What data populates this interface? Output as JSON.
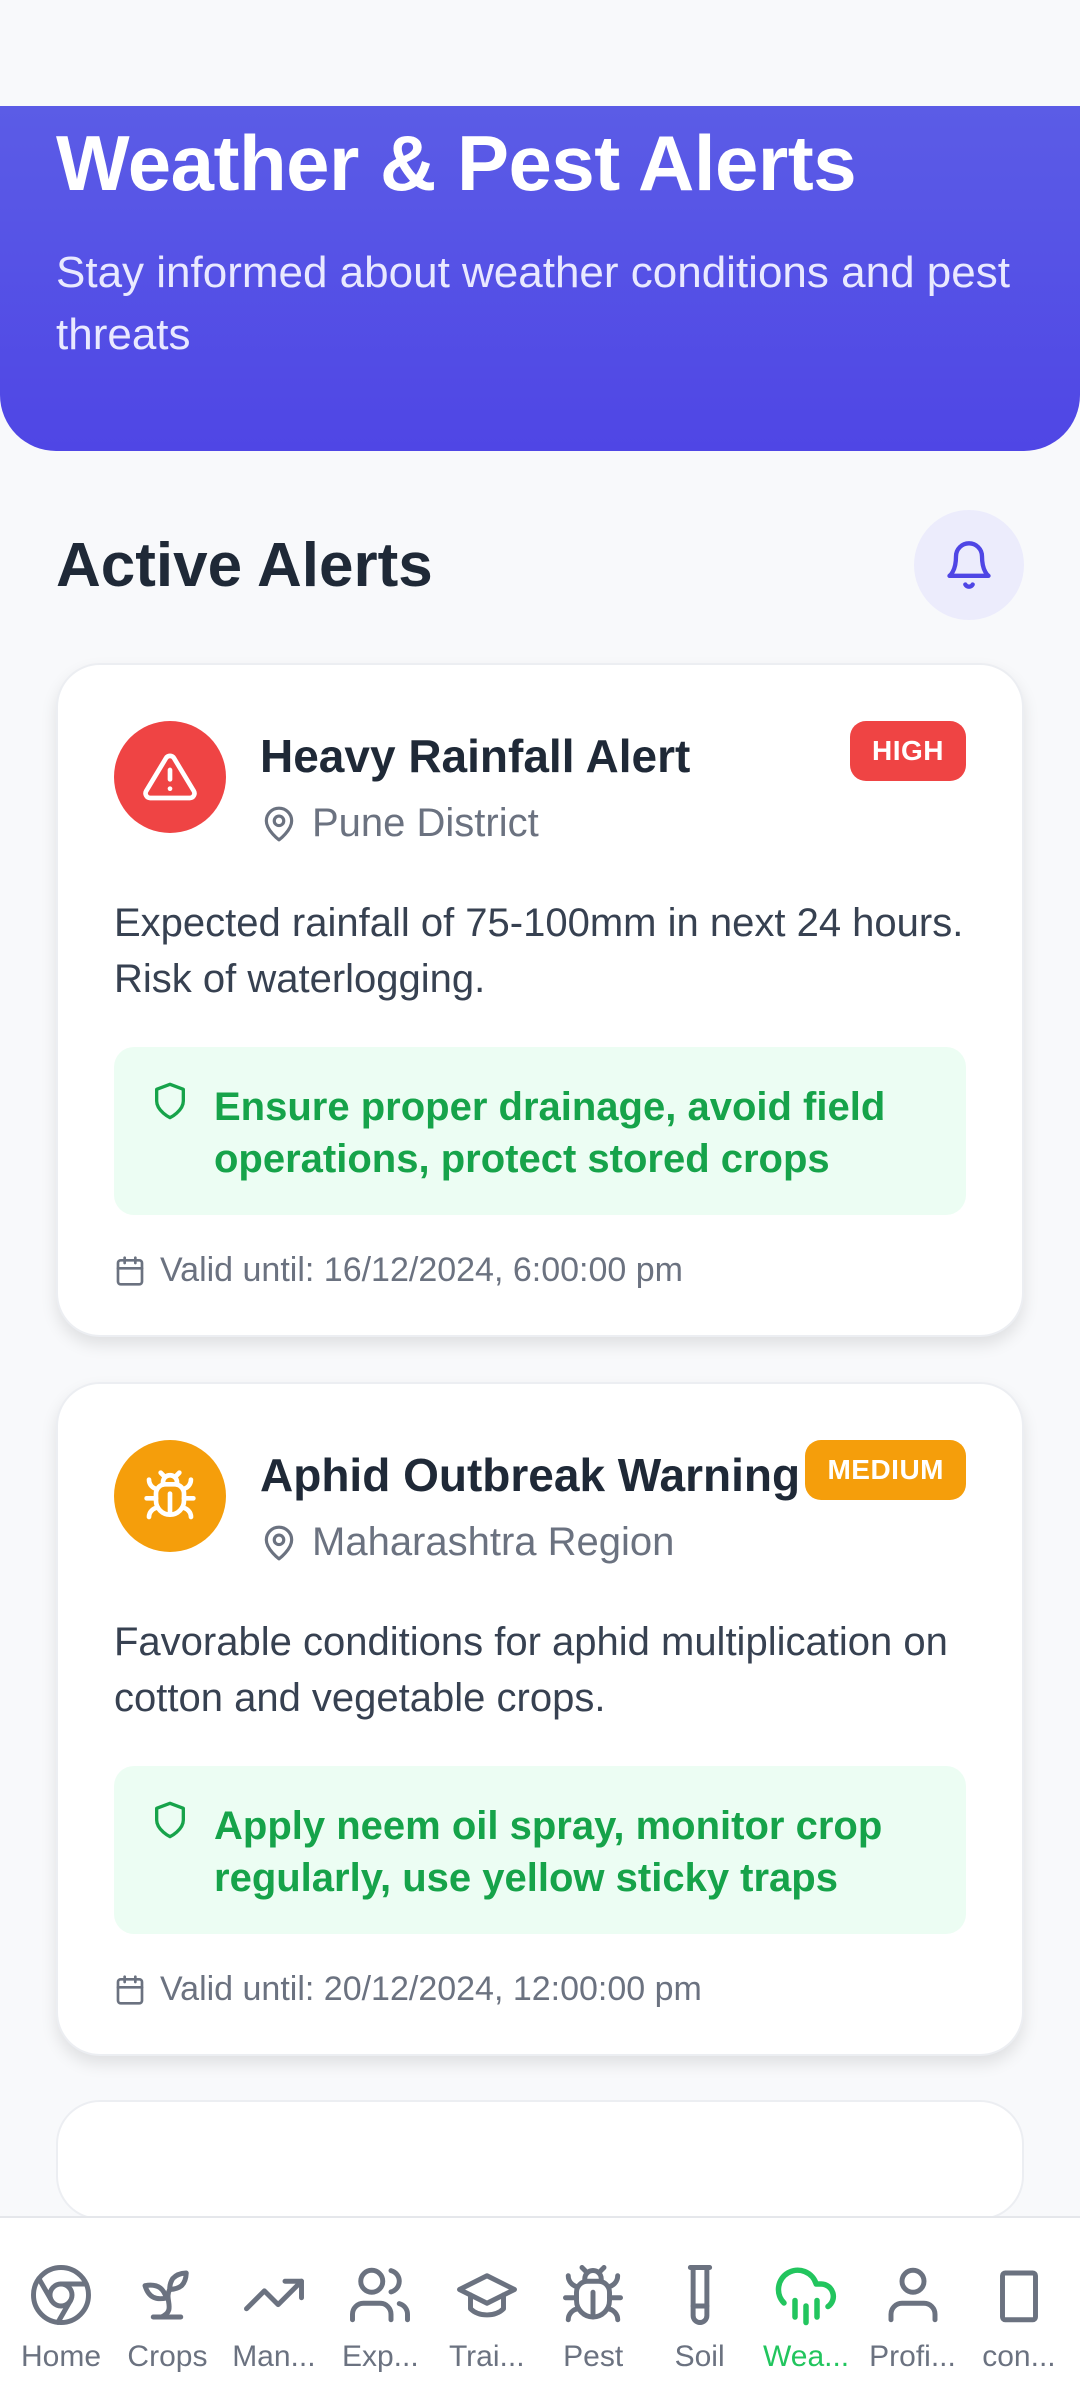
{
  "header": {
    "title": "Weather & Pest Alerts",
    "subtitle": "Stay informed about weather conditions and pest threats"
  },
  "section": {
    "title": "Active Alerts"
  },
  "alerts": [
    {
      "title": "Heavy Rainfall Alert",
      "severity": "HIGH",
      "location": "Pune District",
      "description": "Expected rainfall of 75-100mm in next 24 hours. Risk of waterlogging.",
      "advice": "Ensure proper drainage, avoid field operations, protect stored crops",
      "valid": "Valid until: 16/12/2024, 6:00:00 pm",
      "icon": "warning-icon",
      "color": "#ef4444"
    },
    {
      "title": "Aphid Outbreak Warning",
      "severity": "MEDIUM",
      "location": "Maharashtra Region",
      "description": "Favorable conditions for aphid multiplication on cotton and vegetable crops.",
      "advice": "Apply neem oil spray, monitor crop regularly, use yellow sticky traps",
      "valid": "Valid until: 20/12/2024, 12:00:00 pm",
      "icon": "bug-icon",
      "color": "#f59e0b"
    }
  ],
  "nav": [
    {
      "label": "Home",
      "icon": "chrome-icon"
    },
    {
      "label": "Crops",
      "icon": "sprout-icon"
    },
    {
      "label": "Man...",
      "icon": "trend-icon"
    },
    {
      "label": "Exp...",
      "icon": "users-icon"
    },
    {
      "label": "Trai...",
      "icon": "graduation-cap-icon"
    },
    {
      "label": "Pest",
      "icon": "bug-icon"
    },
    {
      "label": "Soil",
      "icon": "test-tube-icon"
    },
    {
      "label": "Wea...",
      "icon": "cloud-rain-icon",
      "active": true
    },
    {
      "label": "Profi...",
      "icon": "user-icon"
    },
    {
      "label": "con...",
      "icon": "phone-icon"
    }
  ],
  "colors": {
    "brand": "#4f46e5",
    "active_nav": "#22c55e",
    "advice_text": "#16a34a"
  }
}
